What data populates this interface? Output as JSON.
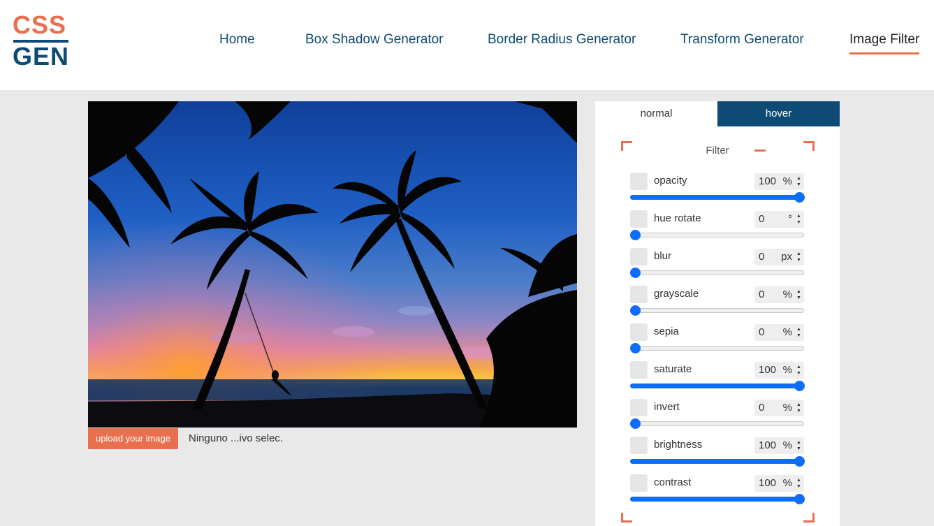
{
  "logo": {
    "top": "CSS",
    "bottom": "GEN"
  },
  "nav": {
    "items": [
      "Home",
      "Box Shadow Generator",
      "Border Radius Generator",
      "Transform Generator",
      "Image Filter"
    ],
    "active": "Image Filter"
  },
  "upload": {
    "button_label": "upload your image",
    "status": "Ninguno ...ivo selec."
  },
  "panel": {
    "tabs": [
      "normal",
      "hover"
    ],
    "active_tab": "hover",
    "section_title": "Filter",
    "filters": [
      {
        "label": "opacity",
        "value": "100",
        "unit": "%",
        "fraction": 1.0
      },
      {
        "label": "hue rotate",
        "value": "0",
        "unit": "°",
        "fraction": 0.0
      },
      {
        "label": "blur",
        "value": "0",
        "unit": "px",
        "fraction": 0.0
      },
      {
        "label": "grayscale",
        "value": "0",
        "unit": "%",
        "fraction": 0.0
      },
      {
        "label": "sepia",
        "value": "0",
        "unit": "%",
        "fraction": 0.0
      },
      {
        "label": "saturate",
        "value": "100",
        "unit": "%",
        "fraction": 1.0
      },
      {
        "label": "invert",
        "value": "0",
        "unit": "%",
        "fraction": 0.0
      },
      {
        "label": "brightness",
        "value": "100",
        "unit": "%",
        "fraction": 1.0
      },
      {
        "label": "contrast",
        "value": "100",
        "unit": "%",
        "fraction": 1.0
      }
    ]
  },
  "colors": {
    "accent": "#e8704f",
    "brand": "#0d4a74",
    "slider": "#0d6efd",
    "background": "#e9e9e9"
  }
}
